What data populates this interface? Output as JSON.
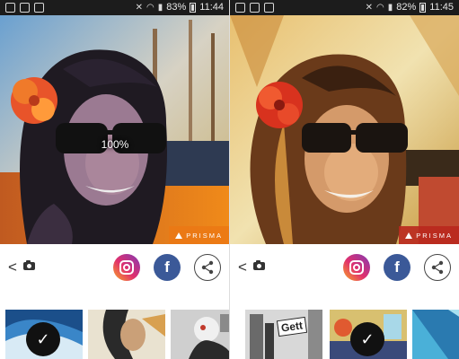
{
  "colors": {
    "status_bar": "#1c1c1c",
    "watermark_left": "#eb7814",
    "watermark_right": "#b9281e",
    "facebook": "#3b5998",
    "check_circle": "#111111"
  },
  "left": {
    "status": {
      "battery": "83%",
      "time": "11:44"
    },
    "artwork": {
      "zoom_label": "100%",
      "watermark": "PRISMA"
    },
    "toolbar": {
      "back_glyph": "<",
      "facebook_glyph": "f"
    },
    "thumbnails": [
      {
        "name": "style-wave",
        "selected": true
      },
      {
        "name": "style-sketch-portrait",
        "selected": false
      },
      {
        "name": "style-mosaic-figure",
        "selected": false
      }
    ]
  },
  "right": {
    "status": {
      "battery": "82%",
      "time": "11:45"
    },
    "artwork": {
      "watermark": "PRISMA"
    },
    "toolbar": {
      "back_glyph": "<",
      "facebook_glyph": "f"
    },
    "thumbnails": [
      {
        "name": "style-gett-comic",
        "label": "Gett",
        "selected": false
      },
      {
        "name": "style-painted",
        "selected": true
      },
      {
        "name": "style-abstract",
        "selected": false
      }
    ]
  },
  "icons": {
    "check": "✓",
    "share": "share-icon",
    "camera": "camera-icon",
    "instagram": "instagram-icon",
    "facebook": "facebook-icon"
  }
}
